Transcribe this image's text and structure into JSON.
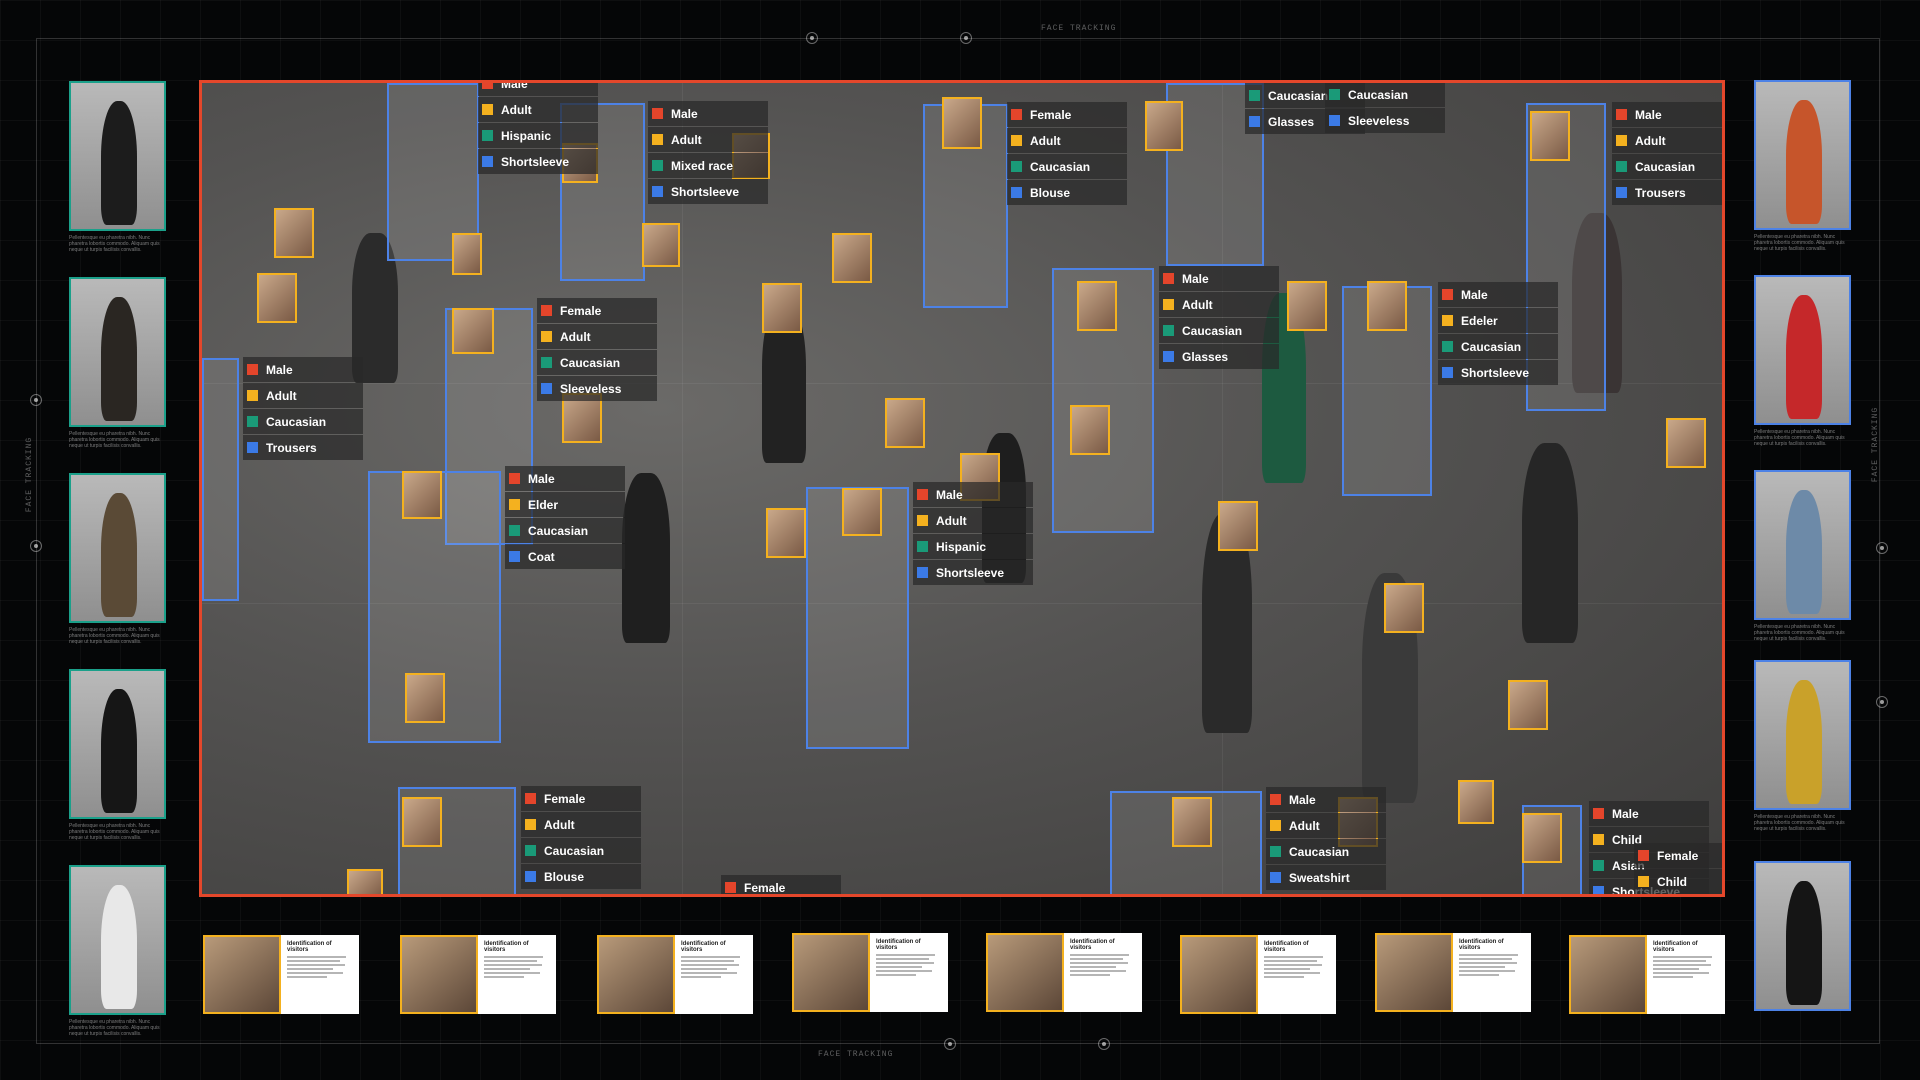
{
  "hud": {
    "top_label": "FACE TRACKING",
    "bottom_label": "FACE TRACKING",
    "left_label": "FACE TRACKING",
    "right_label": "FACE TRACKING"
  },
  "colors": {
    "frame": "#e4472b",
    "face_box": "#f4b11f",
    "body_box": "#4d82e6",
    "tag_gender": "#e4452b",
    "tag_age": "#f4b11f",
    "tag_race": "#1a9a78",
    "tag_clothing": "#3b7ae6"
  },
  "detections": [
    {
      "tags": [
        "Male",
        "Adult",
        "Hispanic",
        "Shortsleeve"
      ]
    },
    {
      "tags": [
        "Male",
        "Adult",
        "Mixed race",
        "Shortsleeve"
      ]
    },
    {
      "tags": [
        "Female",
        "Adult",
        "Caucasian",
        "Blouse"
      ]
    },
    {
      "tags": [
        "Caucasian",
        "Glasses"
      ]
    },
    {
      "tags": [
        "Caucasian",
        "Sleeveless"
      ]
    },
    {
      "tags": [
        "Male",
        "Adult",
        "Caucasian",
        "Trousers"
      ]
    },
    {
      "tags": [
        "Female",
        "Adult",
        "Caucasian",
        "Sleeveless"
      ]
    },
    {
      "tags": [
        "Male",
        "Adult",
        "Caucasian",
        "Trousers"
      ]
    },
    {
      "tags": [
        "Male",
        "Adult",
        "Caucasian",
        "Glasses"
      ]
    },
    {
      "tags": [
        "Male",
        "Edeler",
        "Caucasian",
        "Shortsleeve"
      ]
    },
    {
      "tags": [
        "Male",
        "Elder",
        "Caucasian",
        "Coat"
      ]
    },
    {
      "tags": [
        "Male",
        "Adult",
        "Hispanic",
        "Shortsleeve"
      ]
    },
    {
      "tags": [
        "Female",
        "Adult",
        "Caucasian",
        "Blouse"
      ]
    },
    {
      "tags": [
        "Female"
      ]
    },
    {
      "tags": [
        "Male",
        "Adult",
        "Caucasian",
        "Sweatshirt"
      ]
    },
    {
      "tags": [
        "Male",
        "Child",
        "Asian",
        "Shortsleeve"
      ]
    },
    {
      "tags": [
        "Female",
        "Child"
      ]
    }
  ],
  "thumbnail_caption": "Pellentesque eu pharetra nibh. Nunc pharetra lobortis commodo. Aliquam quis neque ut turpis facilisis convallis.",
  "card_title": "Identification of visitors"
}
